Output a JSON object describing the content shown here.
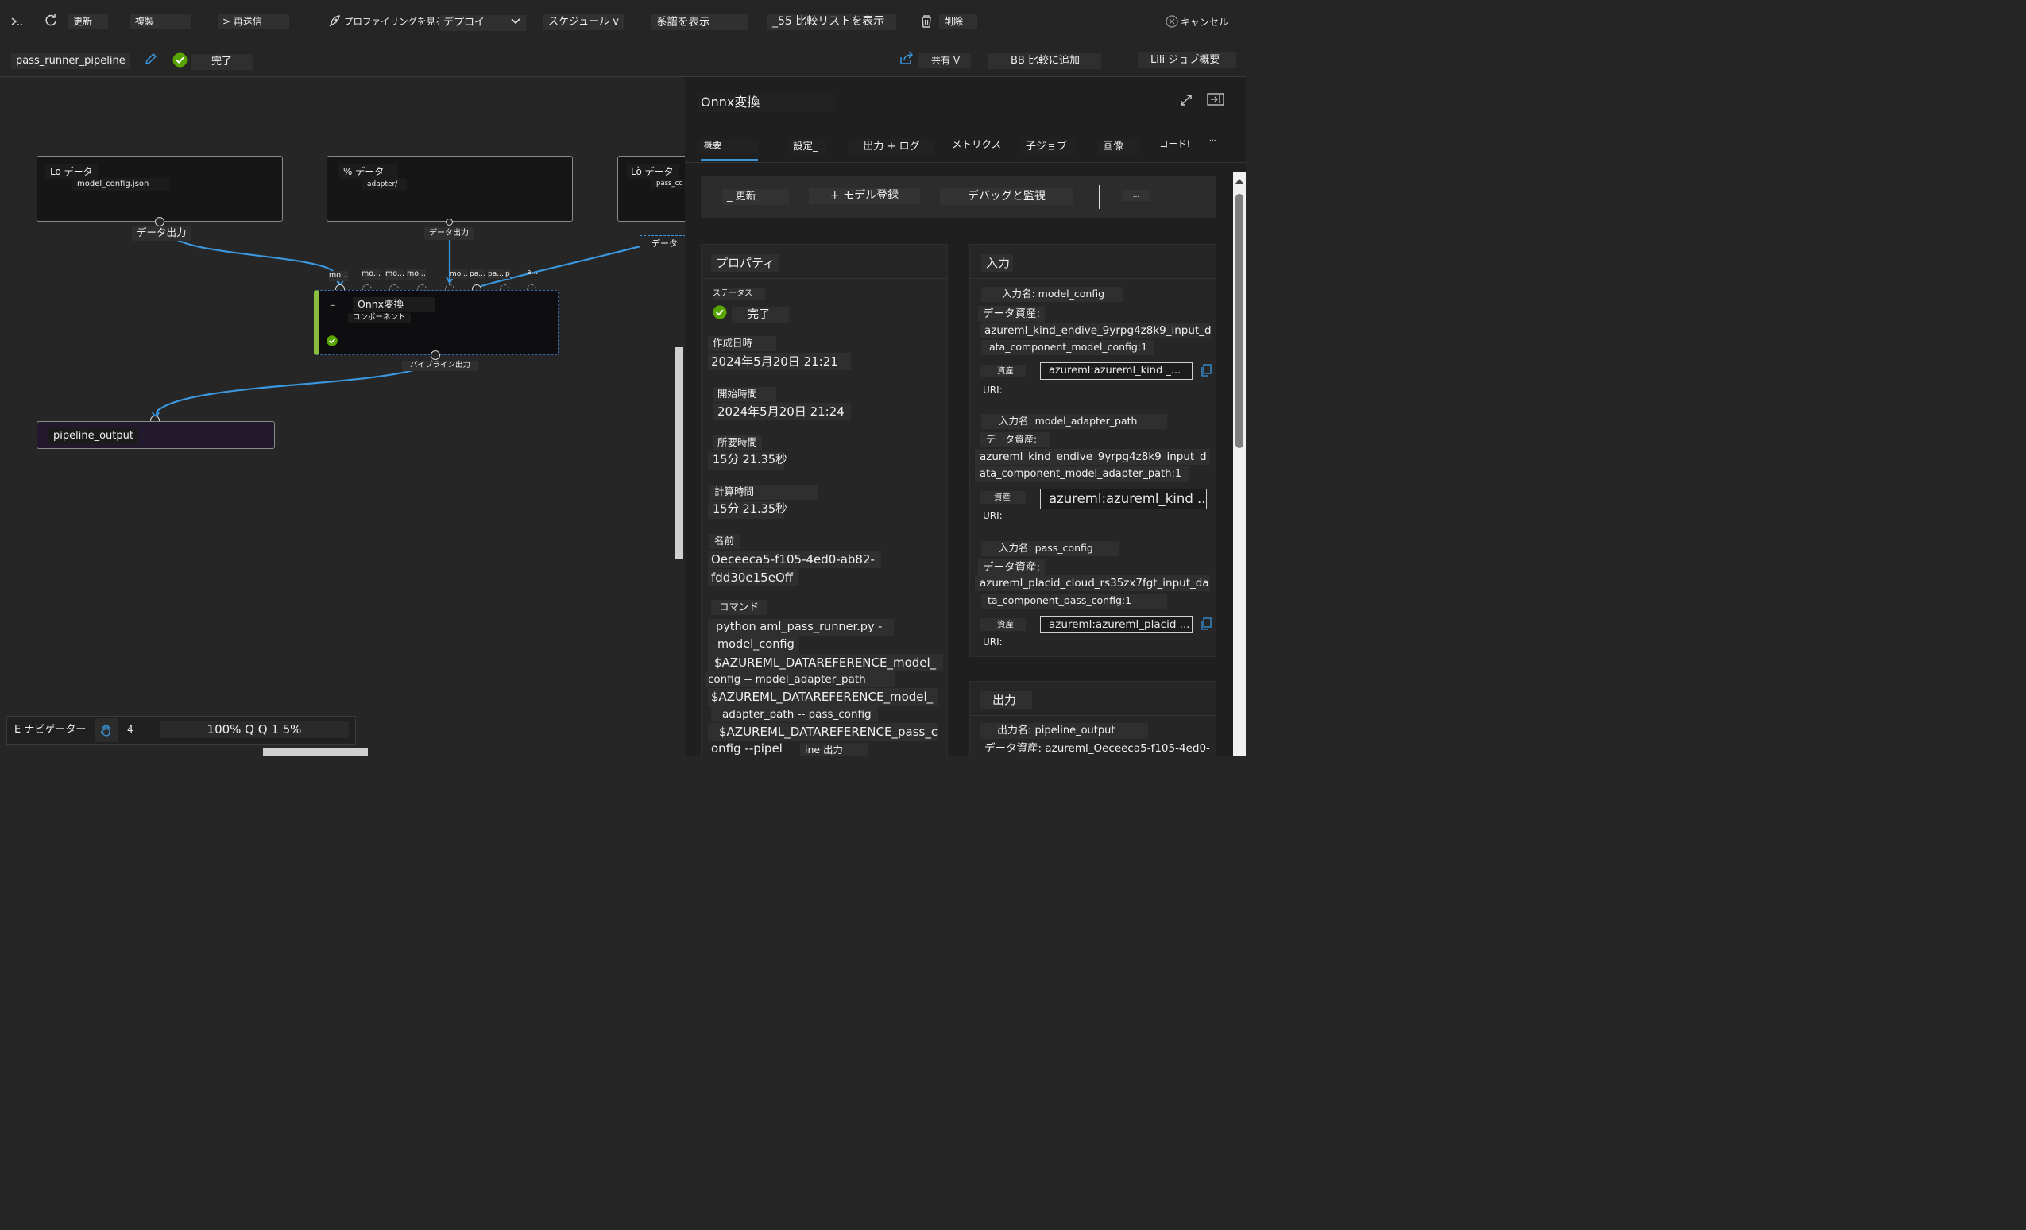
{
  "toolbar": {
    "refresh": "更新",
    "clone": "複製",
    "resubmit": "> 再送信",
    "profiling": "プロファイリングを見る",
    "deploy": "デプロイ",
    "schedule": "スケジュール v",
    "lineage": "系譜を表示",
    "compare_list": "_55 比較リストを表示",
    "delete": "削除",
    "cancel": "キャンセル"
  },
  "run": {
    "name": "pass_runner_pipeline",
    "status": "完了",
    "share": "共有 V",
    "add_compare": "BB 比較に追加",
    "job_overview": "Lili ジョブ概要"
  },
  "canvas": {
    "nodes": [
      {
        "title": "Lo データ",
        "subtitle": "model_config.json",
        "output_label": "データ出力"
      },
      {
        "title": "% データ",
        "subtitle": "adapter/",
        "output_label": "データ出力"
      },
      {
        "title": "Lò データ",
        "subtitle": "pass_cc",
        "output_label": "データ"
      }
    ],
    "component": {
      "title": "Onnx変換",
      "subtitle": "コンポーネント",
      "prefix": "_",
      "port_labels": [
        "mo...",
        "mo...",
        "mo...",
        "mo...",
        "mo...",
        "pa...",
        "pa...",
        "p",
        "a..."
      ],
      "output_label": "パイプライン出力"
    },
    "output_node": {
      "title": "pipeline_output"
    }
  },
  "navigator": {
    "label": "E ナビゲーター",
    "num": "4",
    "zoom": "100% Q Q 1 5%"
  },
  "panel": {
    "title": "Onnx変換",
    "tabs": [
      "概要",
      "設定_",
      "出力 + ログ",
      "メトリクス",
      "子ジョブ",
      "画像",
      "コード!",
      "..."
    ],
    "active_tab": "概要",
    "actions": {
      "refresh": "_  更新",
      "register": "+ モデル登録",
      "debug": "デバッグと監視",
      "more": "..."
    },
    "properties": {
      "heading": "プロパティ",
      "status_label": "ステータス",
      "status_value": "完了",
      "created_label": "作成日時",
      "created_value": "2024年5月20日 21:21",
      "start_label": "開始時間",
      "start_value": "2024年5月20日 21:24",
      "duration_label": "所要時間",
      "duration_value": "15分 21.35秒",
      "compute_label": "計算時間",
      "compute_value": "15分 21.35秒",
      "name_label": "名前",
      "name_value_1": "Oeceeca5-f105-4ed0-ab82-",
      "name_value_2": "fdd30e15eOff",
      "command_label": "コマンド",
      "command_lines": [
        "python aml_pass_runner.py -",
        "model_config",
        "$AZUREML_DATAREFERENCE_model_",
        "config -- model_adapter_path",
        "$AZUREML_DATAREFERENCE_model_",
        "adapter_path -- pass_config",
        "$AZUREML_DATAREFERENCE_pass_c",
        "onfig --pipel",
        "ine 出力"
      ]
    },
    "inputs": {
      "heading": "入力",
      "items": [
        {
          "name": "入力名: model_config",
          "asset_label": "データ資産:",
          "asset_line1": "azureml_kind_endive_9yrpg4z8k9_input_d",
          "asset_line2": "ata_component_model_config:1",
          "uri_label_1": "資産",
          "uri_label_2": "URI:",
          "uri": "azureml:azureml_kind _..."
        },
        {
          "name": "入力名: model_adapter_path",
          "asset_label": "データ資産:",
          "asset_line1": "azureml_kind_endive_9yrpg4z8k9_input_d",
          "asset_line2": "ata_component_model_adapter_path:1",
          "uri_label_1": "資産",
          "uri_label_2": "URI:",
          "uri": "azureml:azureml_kind ..."
        },
        {
          "name": "入力名: pass_config",
          "asset_label": "データ資産:",
          "asset_line1": "azureml_placid_cloud_rs35zx7fgt_input_da",
          "asset_line2": "ta_component_pass_config:1",
          "uri_label_1": "資産",
          "uri_label_2": "URI:",
          "uri": "azureml:azureml_placid ..."
        }
      ]
    },
    "outputs": {
      "heading": "出力",
      "name": "出力名: pipeline_output",
      "asset": "データ資産: azureml_Oeceeca5-f105-4ed0-"
    }
  },
  "colors": {
    "accent": "#3a96dd",
    "success": "#57a300",
    "component_stripe": "#8cbd3f"
  }
}
